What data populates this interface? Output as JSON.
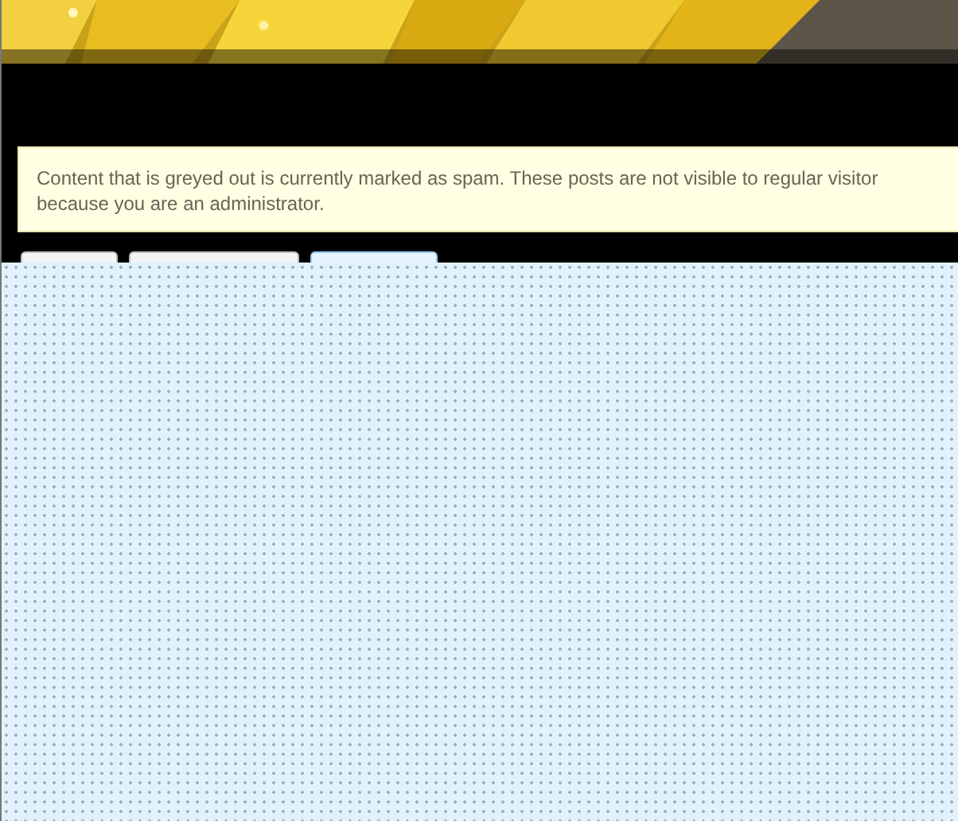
{
  "notice": {
    "lines": [
      "Content that is greyed out is currently marked as spam. These posts are not visible to regular visitor",
      "because you are an administrator."
    ]
  },
  "buttons": [
    {
      "selected": false
    },
    {
      "selected": false
    },
    {
      "selected": true
    }
  ]
}
